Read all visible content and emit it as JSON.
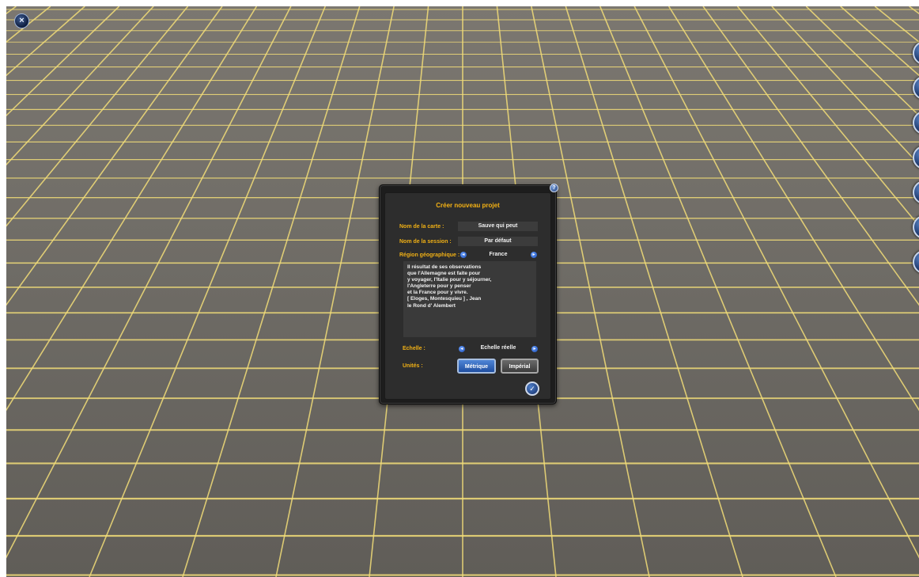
{
  "toolbar": {
    "close_glyph": "×",
    "right_tools": [
      {
        "name": "landscape-tool",
        "icon": "landscape-icon",
        "glyph": "▲"
      },
      {
        "name": "terrain-tool",
        "icon": "terrain-icon",
        "glyph": "◆"
      },
      {
        "name": "track-tool",
        "icon": "track-icon",
        "glyph": "═"
      },
      {
        "name": "building-tool",
        "icon": "building-icon",
        "glyph": "■"
      },
      {
        "name": "tools-tool",
        "icon": "wrench-icon",
        "glyph": "✎"
      },
      {
        "name": "globe-tool",
        "icon": "globe-icon",
        "glyph": "●"
      },
      {
        "name": "settings-tool",
        "icon": "gear-icon",
        "glyph": "✱"
      }
    ]
  },
  "dialog": {
    "title": "Créer nouveau projet",
    "help_glyph": "?",
    "map_name_label": "Nom de la carte :",
    "map_name_value": "Sauve qui peut",
    "session_name_label": "Nom de la session :",
    "session_name_value": "Par défaut",
    "region_label": "Région géographique :",
    "region_value": "France",
    "description": "Il résultat de ses observations\nque l'Allemagne est faite pour\ny voyager, l'Italie pour y séjourner,\nl'Angleterre pour y penser\net la France pour y vivre.\n[ Eloges, Montesquieu ] , Jean\nle Rond d' Alembert",
    "scale_label": "Echelle :",
    "scale_value": "Echelle réelle",
    "units_label": "Unités :",
    "metric_label": "Métrique",
    "imperial_label": "Impérial",
    "selected_unit": "Métrique",
    "arrow_left": "◂",
    "arrow_right": "▸",
    "ok_glyph": "✓"
  },
  "colors": {
    "accent": "#f0b015",
    "grid_line": "#f2dd78",
    "ground": "#6f6c66",
    "button_blue": "#1f4ea0"
  }
}
